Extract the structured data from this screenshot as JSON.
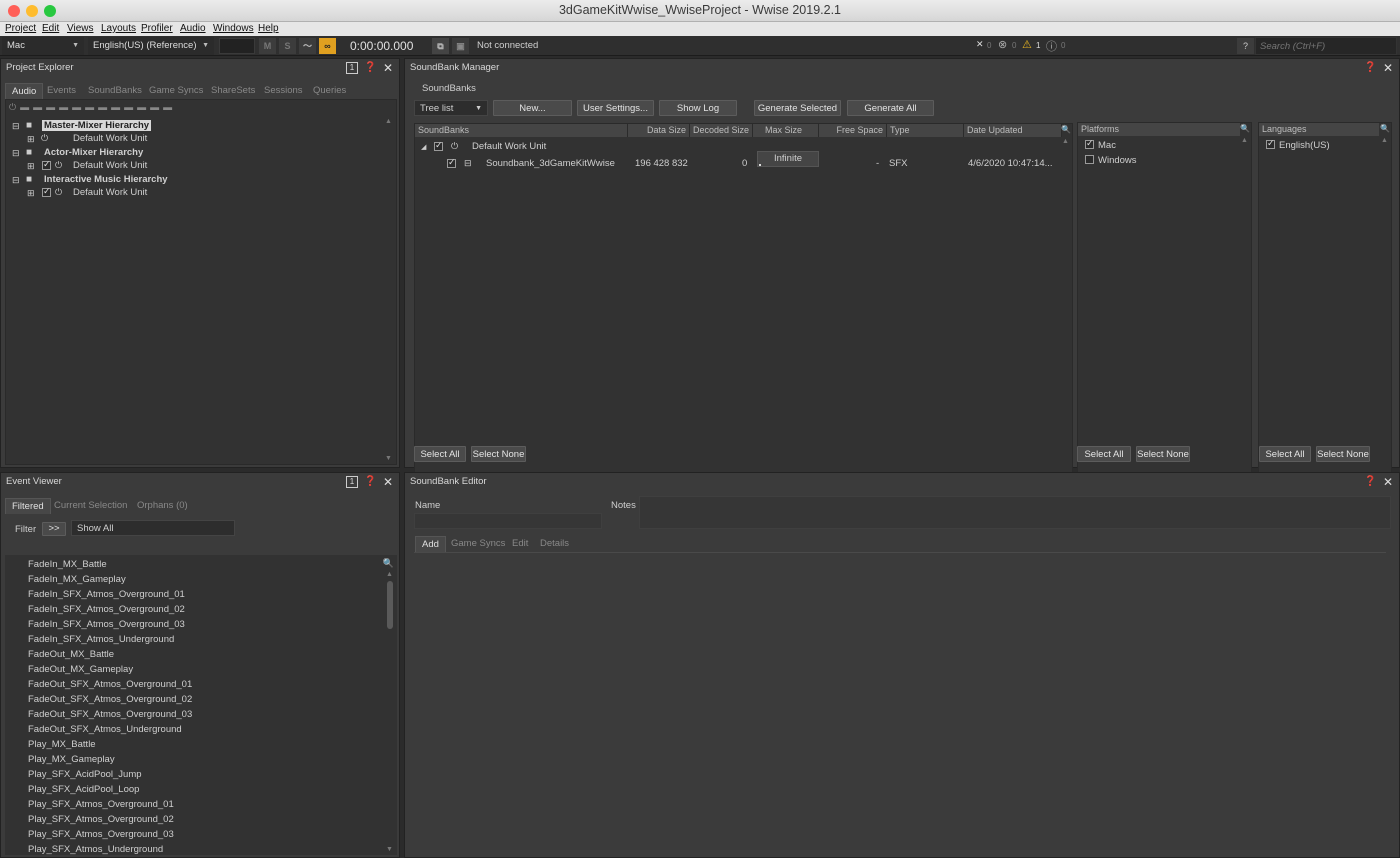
{
  "window": {
    "title": "3dGameKitWwise_WwiseProject - Wwise 2019.2.1"
  },
  "menu": [
    "Project",
    "Edit",
    "Views",
    "Layouts",
    "Profiler",
    "Audio",
    "Windows",
    "Help"
  ],
  "toolbar": {
    "platform": "Mac",
    "language": "English(US) (Reference)",
    "mute": "M",
    "solo": "S",
    "time": "0:00:00.000",
    "connection": "Not connected",
    "errors": "0",
    "errors2": "0",
    "warnings": "1",
    "info": "0",
    "help": "?",
    "search_placeholder": "Search (Ctrl+F)"
  },
  "project_explorer": {
    "title": "Project Explorer",
    "layout_num": "1",
    "tabs": [
      "Audio",
      "Events",
      "SoundBanks",
      "Game Syncs",
      "ShareSets",
      "Sessions",
      "Queries"
    ],
    "tree": [
      {
        "label": "Master-Mixer Hierarchy",
        "child": "Default Work Unit"
      },
      {
        "label": "Actor-Mixer Hierarchy",
        "child": "Default Work Unit"
      },
      {
        "label": "Interactive Music Hierarchy",
        "child": "Default Work Unit"
      }
    ]
  },
  "event_viewer": {
    "title": "Event Viewer",
    "layout_num": "1",
    "tabs": [
      "Filtered",
      "Current Selection",
      "Orphans (0)"
    ],
    "filter_label": "Filter",
    "filter_btn": ">>",
    "filter_value": "Show All",
    "events": [
      "FadeIn_MX_Battle",
      "FadeIn_MX_Gameplay",
      "FadeIn_SFX_Atmos_Overground_01",
      "FadeIn_SFX_Atmos_Overground_02",
      "FadeIn_SFX_Atmos_Overground_03",
      "FadeIn_SFX_Atmos_Underground",
      "FadeOut_MX_Battle",
      "FadeOut_MX_Gameplay",
      "FadeOut_SFX_Atmos_Overground_01",
      "FadeOut_SFX_Atmos_Overground_02",
      "FadeOut_SFX_Atmos_Overground_03",
      "FadeOut_SFX_Atmos_Underground",
      "Play_MX_Battle",
      "Play_MX_Gameplay",
      "Play_SFX_AcidPool_Jump",
      "Play_SFX_AcidPool_Loop",
      "Play_SFX_Atmos_Overground_01",
      "Play_SFX_Atmos_Overground_02",
      "Play_SFX_Atmos_Overground_03",
      "Play_SFX_Atmos_Underground"
    ]
  },
  "soundbank_manager": {
    "title": "SoundBank Manager",
    "subtitle": "SoundBanks",
    "view_mode": "Tree list",
    "buttons": {
      "new": "New...",
      "user_settings": "User Settings...",
      "show_log": "Show Log",
      "gen_selected": "Generate Selected",
      "gen_all": "Generate All"
    },
    "columns": [
      "SoundBanks",
      "Data Size",
      "Decoded Size",
      "Max Size",
      "Free Space",
      "Type",
      "Date Updated"
    ],
    "work_unit": "Default Work Unit",
    "row": {
      "name": "Soundbank_3dGameKitWwise",
      "data_size": "196 428 832",
      "decoded_size": "0",
      "max_size": "Infinite",
      "free_space": "-",
      "type": "SFX",
      "date": "4/6/2020 10:47:14..."
    },
    "platforms": {
      "title": "Platforms",
      "items": [
        {
          "label": "Mac",
          "checked": true
        },
        {
          "label": "Windows",
          "checked": false
        }
      ]
    },
    "languages": {
      "title": "Languages",
      "items": [
        {
          "label": "English(US)",
          "checked": true
        }
      ]
    },
    "select_all": "Select All",
    "select_none": "Select None"
  },
  "soundbank_editor": {
    "title": "SoundBank Editor",
    "name_label": "Name",
    "notes_label": "Notes",
    "tabs": [
      "Add",
      "Game Syncs",
      "Edit",
      "Details"
    ]
  },
  "colors": {
    "accent_orange": "#e0a020",
    "warning": "#e8b520",
    "panel": "#3b3b3b",
    "dark": "#2b2b2b"
  }
}
